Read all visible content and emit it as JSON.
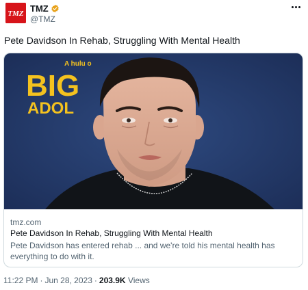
{
  "account": {
    "display_name": "TMZ",
    "handle": "@TMZ",
    "avatar_text": "TMZ",
    "avatar_color": "#d7141a",
    "verified_color": "#e8a21a"
  },
  "tweet": {
    "text": "Pete Davidson In Rehab, Struggling With Mental Health"
  },
  "card": {
    "image_alt": "Pete Davidson",
    "backdrop_text_small": "A hulu o",
    "backdrop_text_line1": "BIG",
    "backdrop_text_line2": "ADOL",
    "domain": "tmz.com",
    "title": "Pete Davidson In Rehab, Struggling With Mental Health",
    "description": "Pete Davidson has entered rehab ... and we're told his mental health has everything to do with it."
  },
  "meta": {
    "time": "11:22 PM",
    "separator": "·",
    "date": "Jun 28, 2023",
    "views_count": "203.9K",
    "views_label": "Views"
  },
  "colors": {
    "text_primary": "#0f1419",
    "text_secondary": "#536471",
    "border": "#cfd9de",
    "backdrop_blue": "#243a6b",
    "backdrop_yellow": "#f4c21f"
  }
}
